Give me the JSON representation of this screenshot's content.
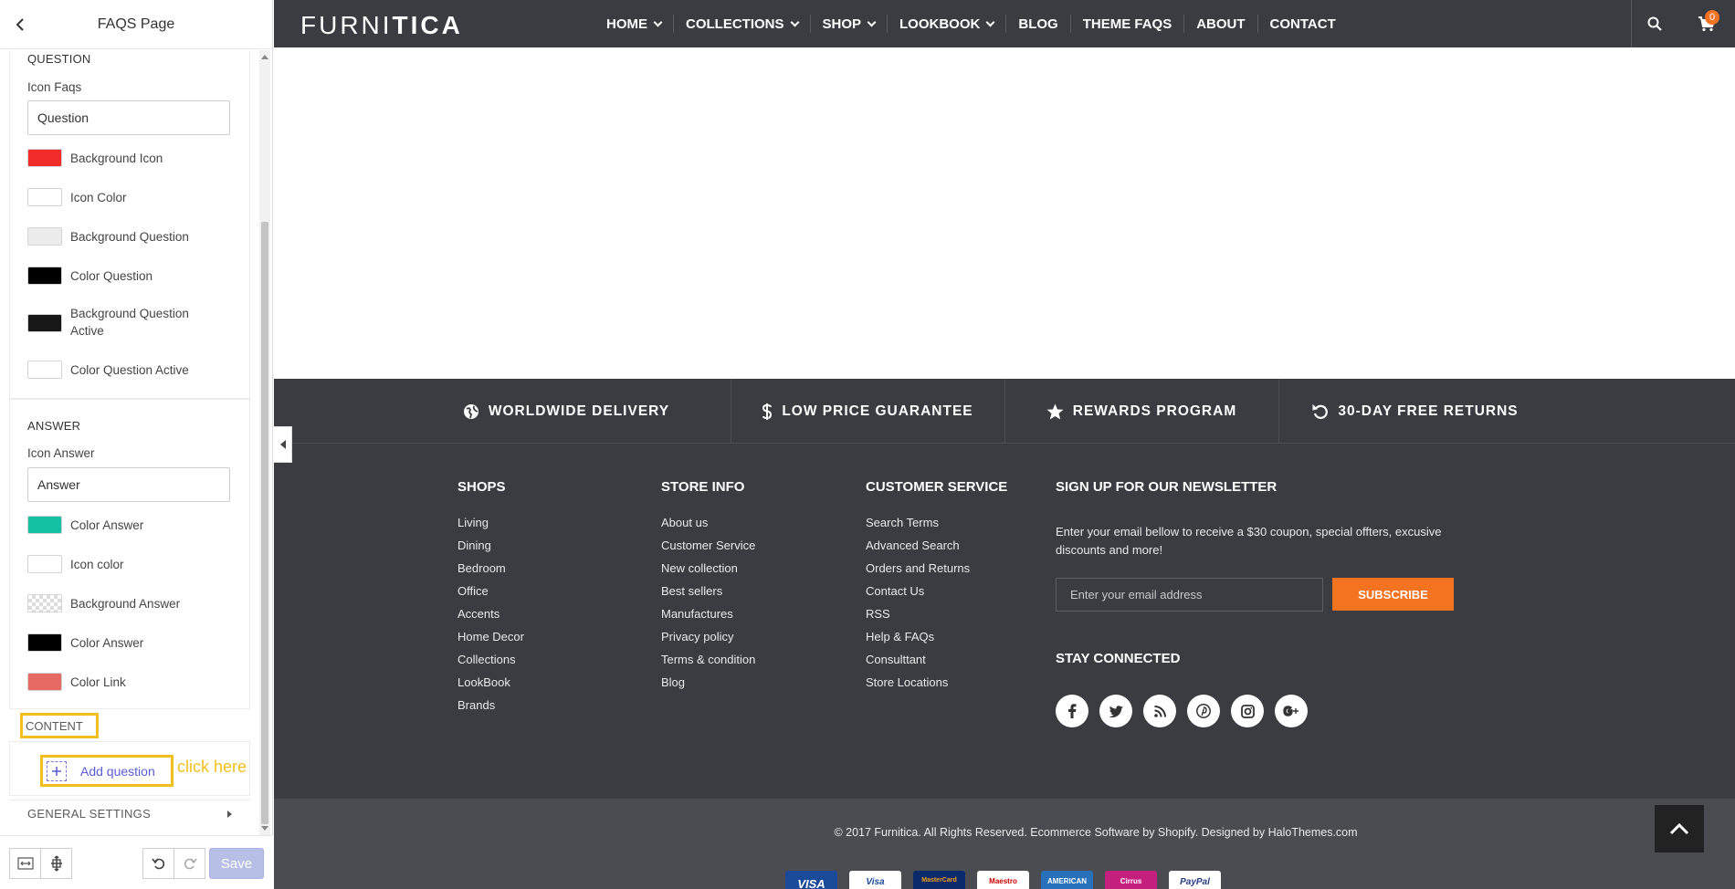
{
  "editor": {
    "title": "FAQS Page",
    "question_section": {
      "title": "QUESTION",
      "icon_label": "Icon Faqs",
      "icon_value": "Question",
      "swatches": [
        {
          "label": "Background Icon",
          "color": "#f22b2b"
        },
        {
          "label": "Icon Color",
          "color": "#ffffff"
        },
        {
          "label": "Background Question",
          "color": "#ececec"
        },
        {
          "label": "Color Question",
          "color": "#000000"
        },
        {
          "label": "Background Question Active",
          "color": "#171717"
        },
        {
          "label": "Color Question Active",
          "color": "#ffffff"
        }
      ]
    },
    "answer_section": {
      "title": "ANSWER",
      "icon_label": "Icon Answer",
      "icon_value": "Answer",
      "swatches": [
        {
          "label": "Color Answer",
          "color": "#14c2a3"
        },
        {
          "label": "Icon color",
          "color": "#ffffff"
        },
        {
          "label": "Background Answer",
          "color": "transparent"
        },
        {
          "label": "Color Answer",
          "color": "#000000"
        },
        {
          "label": "Color Link",
          "color": "#e86a64"
        }
      ]
    },
    "content_label": "CONTENT",
    "add_question_label": "Add question",
    "annotation": "click here",
    "general_settings_label": "GENERAL SETTINGS",
    "save_label": "Save"
  },
  "store": {
    "logo_light": "FURNI",
    "logo_bold": "TICA",
    "nav": [
      {
        "label": "HOME",
        "dropdown": true
      },
      {
        "label": "COLLECTIONS",
        "dropdown": true
      },
      {
        "label": "SHOP",
        "dropdown": true
      },
      {
        "label": "LOOKBOOK",
        "dropdown": true
      },
      {
        "label": "BLOG",
        "dropdown": false
      },
      {
        "label": "THEME FAQS",
        "dropdown": false
      },
      {
        "label": "ABOUT",
        "dropdown": false
      },
      {
        "label": "CONTACT",
        "dropdown": false
      }
    ],
    "cart_count": "0",
    "features": [
      {
        "label": "WORLDWIDE DELIVERY",
        "icon": "globe-icon"
      },
      {
        "label": "LOW PRICE GUARANTEE",
        "icon": "dollar-icon"
      },
      {
        "label": "REWARDS PROGRAM",
        "icon": "star-icon"
      },
      {
        "label": "30-DAY FREE RETURNS",
        "icon": "return-icon"
      }
    ],
    "columns": [
      {
        "title": "SHOPS",
        "links": [
          "Living",
          "Dining",
          "Bedroom",
          "Office",
          "Accents",
          "Home Decor",
          "Collections",
          "LookBook",
          "Brands"
        ]
      },
      {
        "title": "STORE INFO",
        "links": [
          "About us",
          "Customer Service",
          "New collection",
          "Best sellers",
          "Manufactures",
          "Privacy policy",
          "Terms & condition",
          "Blog"
        ]
      },
      {
        "title": "CUSTOMER SERVICE",
        "links": [
          "Search Terms",
          "Advanced Search",
          "Orders and Returns",
          "Contact Us",
          "RSS",
          "Help & FAQs",
          "Consulttant",
          "Store Locations"
        ]
      }
    ],
    "newsletter": {
      "title": "SIGN UP FOR OUR NEWSLETTER",
      "text": "Enter your email bellow to receive a $30 coupon, special offters, excusive discounts and more!",
      "placeholder": "Enter your email address",
      "button": "SUBSCRIBE"
    },
    "stay_connected": "STAY CONNECTED",
    "social": [
      "facebook-icon",
      "twitter-icon",
      "rss-icon",
      "pinterest-icon",
      "instagram-icon",
      "google-plus-icon"
    ],
    "copyright": "© 2017 Furnitica. All Rights Reserved. Ecommerce Software by Shopify. Designed by HaloThemes.com",
    "payments": [
      {
        "name": "VISA",
        "bg": "#1a4b9b",
        "fg": "#ffffff"
      },
      {
        "name": "Visa",
        "bg": "#ffffff",
        "fg": "#1a4b9b"
      },
      {
        "name": "MasterCard",
        "bg": "#0a2a6b",
        "fg": "#f79e1b"
      },
      {
        "name": "Maestro",
        "bg": "#ffffff",
        "fg": "#cc0000"
      },
      {
        "name": "AMERICAN",
        "bg": "#2671b9",
        "fg": "#ffffff"
      },
      {
        "name": "Cirrus",
        "bg": "#c41f7e",
        "fg": "#ffffff"
      },
      {
        "name": "PayPal",
        "bg": "#ffffff",
        "fg": "#253b80"
      }
    ]
  }
}
